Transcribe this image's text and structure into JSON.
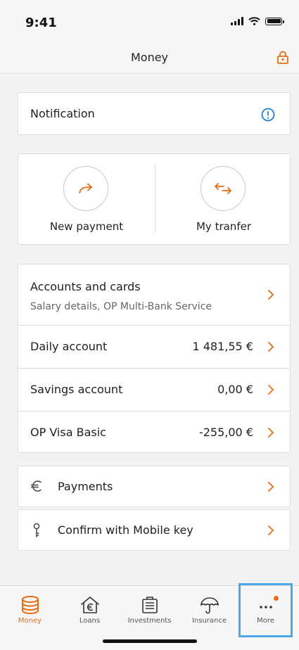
{
  "status": {
    "time": "9:41"
  },
  "header": {
    "title": "Money"
  },
  "notification": {
    "label": "Notification"
  },
  "actions": [
    {
      "label": "New payment",
      "icon": "arrow-right-up-icon"
    },
    {
      "label": "My tranfer",
      "icon": "transfer-arrows-icon"
    }
  ],
  "accounts": {
    "title": "Accounts and cards",
    "subtitle": "Salary details, OP Multi-Bank Service",
    "rows": [
      {
        "name": "Daily account",
        "value": "1 481,55 €"
      },
      {
        "name": "Savings account",
        "value": "0,00 €"
      },
      {
        "name": "OP Visa Basic",
        "value": "-255,00 €"
      }
    ]
  },
  "links": {
    "payments": {
      "label": "Payments",
      "icon": "euro-icon"
    },
    "mobile_key": {
      "label": "Confirm with Mobile key",
      "icon": "key-icon"
    }
  },
  "tabs": [
    {
      "label": "Money",
      "icon": "coins-icon",
      "active": true
    },
    {
      "label": "Loans",
      "icon": "house-euro-icon"
    },
    {
      "label": "Investments",
      "icon": "briefcase-icon"
    },
    {
      "label": "Insurance",
      "icon": "umbrella-icon"
    },
    {
      "label": "More",
      "icon": "more-dots-icon",
      "badge": true
    }
  ],
  "colors": {
    "accent": "#ea6a12",
    "info": "#1f7fd6",
    "highlight": "#4aa9e8"
  }
}
